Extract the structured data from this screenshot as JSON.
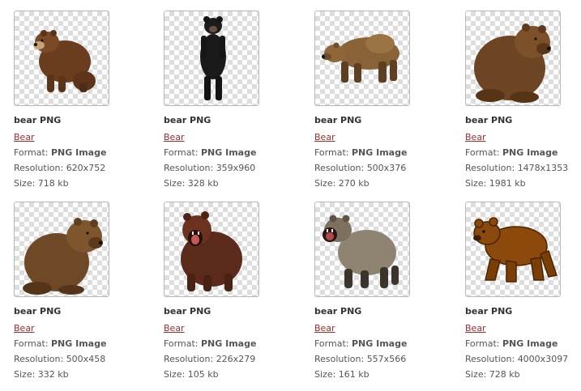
{
  "labels": {
    "format_label": "Format:",
    "resolution_label": "Resolution:",
    "size_label": "Size:"
  },
  "colors": {
    "category_link": "#a52a2a",
    "text": "#555555",
    "title": "#333333",
    "thumb_border": "#b9b9b9"
  },
  "items": [
    {
      "title": "bear PNG",
      "category": "Bear",
      "format": "PNG Image",
      "resolution": "620x752",
      "size": "718 kb",
      "icon": "brown-bear-sitting-image"
    },
    {
      "title": "bear PNG",
      "category": "Bear",
      "format": "PNG Image",
      "resolution": "359x960",
      "size": "328 kb",
      "icon": "black-bear-standing-image"
    },
    {
      "title": "bear PNG",
      "category": "Bear",
      "format": "PNG Image",
      "resolution": "500x376",
      "size": "270 kb",
      "icon": "grizzly-bear-walking-image"
    },
    {
      "title": "bear PNG",
      "category": "Bear",
      "format": "PNG Image",
      "resolution": "1478x1353",
      "size": "1981 kb",
      "icon": "brown-bear-sitting-image"
    },
    {
      "title": "bear PNG",
      "category": "Bear",
      "format": "PNG Image",
      "resolution": "500x458",
      "size": "332 kb",
      "icon": "brown-bear-sitting-image"
    },
    {
      "title": "bear PNG",
      "category": "Bear",
      "format": "PNG Image",
      "resolution": "226x279",
      "size": "105 kb",
      "icon": "roaring-bear-front-image"
    },
    {
      "title": "bear PNG",
      "category": "Bear",
      "format": "PNG Image",
      "resolution": "557x566",
      "size": "161 kb",
      "icon": "roaring-bear-grey-image"
    },
    {
      "title": "bear PNG",
      "category": "Bear",
      "format": "PNG Image",
      "resolution": "4000x3097",
      "size": "728 kb",
      "icon": "cartoon-bear-walking-image"
    }
  ]
}
